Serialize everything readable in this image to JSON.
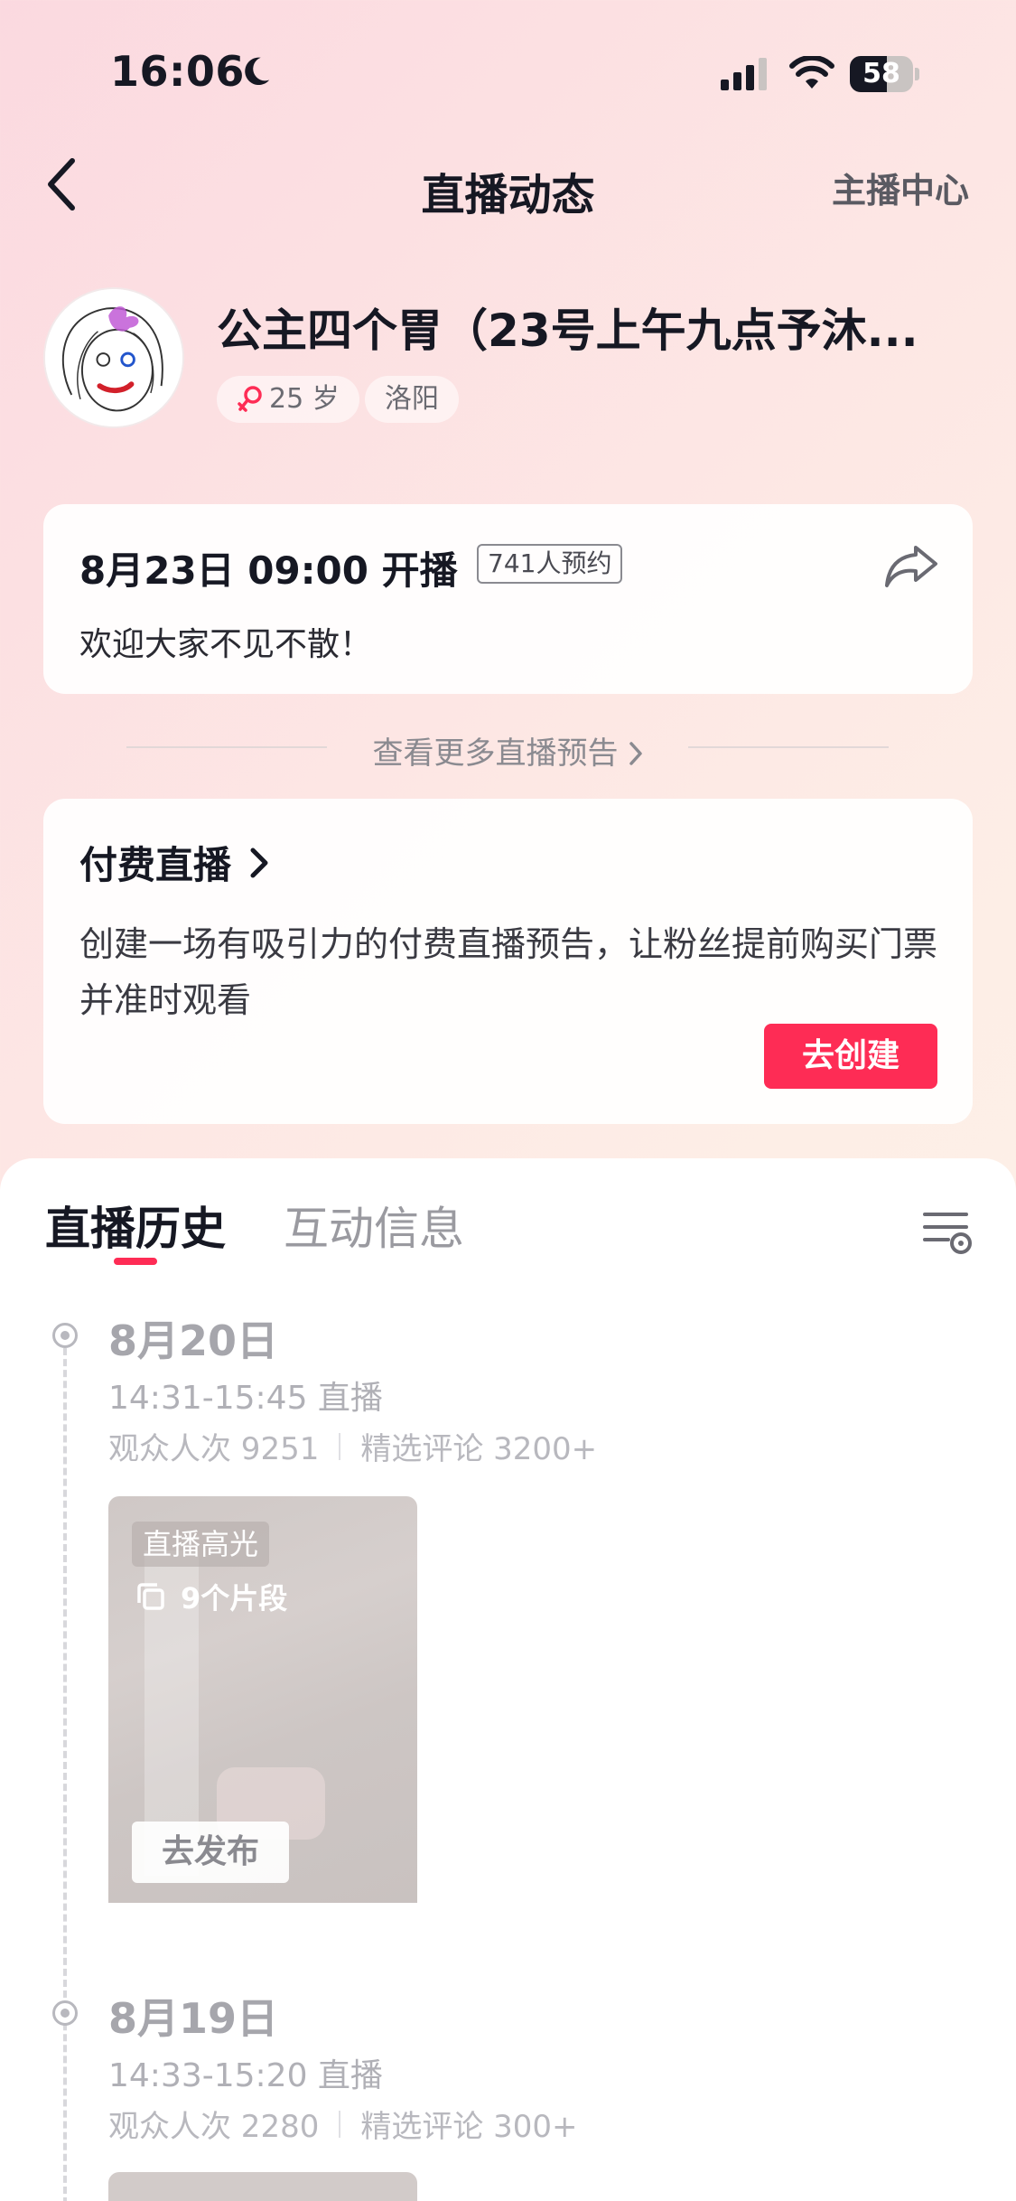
{
  "status_bar": {
    "time": "16:06",
    "battery": "58",
    "battery_percent": 58
  },
  "nav": {
    "title": "直播动态",
    "right_link": "主播中心"
  },
  "profile": {
    "name": "公主四个胃（23号上午九点予沐...",
    "age": "25 岁",
    "city": "洛阳"
  },
  "preview": {
    "time": "8月23日 09:00 开播",
    "reservations": "741人预约",
    "message": "欢迎大家不见不散！"
  },
  "more_previews": "查看更多直播预告",
  "paid_live": {
    "title": "付费直播",
    "description": "创建一场有吸引力的付费直播预告，让粉丝提前购买门票并准时观看",
    "button": "去创建"
  },
  "tabs": {
    "history": "直播历史",
    "interaction": "互动信息"
  },
  "history": [
    {
      "date": "8月20日",
      "time": "14:31-15:45 直播",
      "viewers": "观众人次 9251",
      "comments": "精选评论 3200+",
      "highlight_badge": "直播高光",
      "clips": "9个片段",
      "publish_button": "去发布"
    },
    {
      "date": "8月19日",
      "time": "14:33-15:20 直播",
      "viewers": "观众人次 2280",
      "comments": "精选评论 300+"
    }
  ],
  "colors": {
    "accent": "#fe2c55",
    "text_primary": "#161823",
    "text_muted": "#a6a6ac"
  },
  "icons": [
    "moon-icon",
    "signal-icon",
    "wifi-icon",
    "battery-icon",
    "back-arrow-icon",
    "female-icon",
    "share-icon",
    "chevron-right-icon",
    "filter-settings-icon",
    "clips-icon"
  ]
}
